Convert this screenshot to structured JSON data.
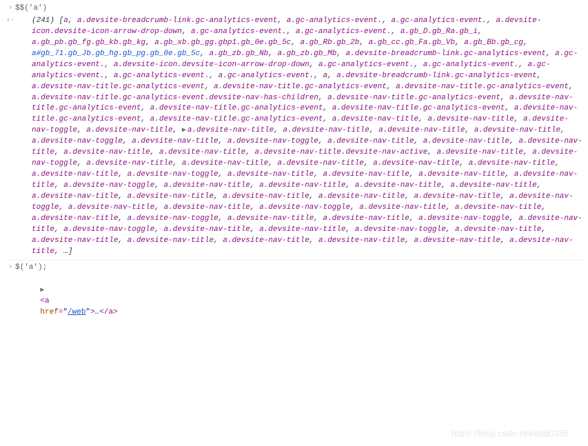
{
  "prompts": {
    "input1": "$$('a')",
    "input2": "$('a');"
  },
  "result1": {
    "count": "(241)",
    "openBracket": "[",
    "closeBracket": "]",
    "ellipsis": "…",
    "tokens": [
      {
        "t": "a",
        "c": "jsvar"
      },
      {
        "t": "a.devsite-breadcrumb-link.gc-analytics-event",
        "c": "sel-purple"
      },
      {
        "t": "a.gc-analytics-event.",
        "c": "sel-purple"
      },
      {
        "t": "a.gc-analytics-event.",
        "c": "sel-purple"
      },
      {
        "t": "a.devsite-icon.devsite-icon-arrow-drop-down",
        "c": "sel-purple"
      },
      {
        "t": "a.gc-analytics-event.",
        "c": "sel-purple"
      },
      {
        "t": "a.gc-analytics-event.",
        "c": "sel-purple"
      },
      {
        "t": "a.gb_D.gb_Ra.gb_i",
        "c": "sel-purple"
      },
      {
        "t": "a.gb_pb.gb_fg.gb_kb.gb_kg",
        "c": "sel-purple"
      },
      {
        "t": "a.gb_xb.gb_gg.gbp1.gb_0e.gb_5c",
        "c": "sel-purple"
      },
      {
        "t": "a.gb_Rb.gb_2b",
        "c": "sel-purple"
      },
      {
        "t": "a.gb_cc.gb_Fa.gb_Vb",
        "c": "sel-purple"
      },
      {
        "t": "a.gb_Bb.gb_cg",
        "c": "sel-purple"
      },
      {
        "t": "a#gb_71.gb_Jb.gb_hg.gb_pg.gb_0e.gb_5c",
        "c": "jsblue"
      },
      {
        "t": "a.gb_zb.gb_Nb",
        "c": "sel-purple"
      },
      {
        "t": "a.gb_zb.gb_Mb",
        "c": "sel-purple"
      },
      {
        "t": "a.devsite-breadcrumb-link.gc-analytics-event",
        "c": "sel-purple"
      },
      {
        "t": "a.gc-analytics-event.",
        "c": "sel-purple"
      },
      {
        "t": "a.devsite-icon.devsite-icon-arrow-drop-down",
        "c": "sel-purple"
      },
      {
        "t": "a.gc-analytics-event.",
        "c": "sel-purple"
      },
      {
        "t": "a.gc-analytics-event.",
        "c": "sel-purple"
      },
      {
        "t": "a.gc-analytics-event.",
        "c": "sel-purple"
      },
      {
        "t": "a.gc-analytics-event.",
        "c": "sel-purple"
      },
      {
        "t": "a.gc-analytics-event.",
        "c": "sel-purple"
      },
      {
        "t": "a",
        "c": "jsvar"
      },
      {
        "t": "a.devsite-breadcrumb-link.gc-analytics-event",
        "c": "sel-purple"
      },
      {
        "t": "a.devsite-nav-title.gc-analytics-event",
        "c": "sel-purple"
      },
      {
        "t": "a.devsite-nav-title.gc-analytics-event",
        "c": "sel-purple"
      },
      {
        "t": "a.devsite-nav-title.gc-analytics-event",
        "c": "sel-purple"
      },
      {
        "t": "a.devsite-nav-title.gc-analytics-event.devsite-nav-has-children",
        "c": "sel-purple"
      },
      {
        "t": "a.devsite-nav-title.gc-analytics-event",
        "c": "sel-purple"
      },
      {
        "t": "a.devsite-nav-title.gc-analytics-event",
        "c": "sel-purple"
      },
      {
        "t": "a.devsite-nav-title.gc-analytics-event",
        "c": "sel-purple"
      },
      {
        "t": "a.devsite-nav-title.gc-analytics-event",
        "c": "sel-purple"
      },
      {
        "t": "a.devsite-nav-title.gc-analytics-event",
        "c": "sel-purple"
      },
      {
        "t": "a.devsite-nav-title.gc-analytics-event",
        "c": "sel-purple"
      },
      {
        "t": "a.devsite-nav-title",
        "c": "sel-purple"
      },
      {
        "t": "a.devsite-nav-title",
        "c": "sel-purple"
      },
      {
        "t": "a.devsite-nav-toggle",
        "c": "sel-purple"
      },
      {
        "t": "a.devsite-nav-title",
        "c": "sel-purple"
      },
      {
        "t": "a.devsite-nav-title",
        "c": "sel-purple"
      },
      {
        "t": "a.devsite-nav-title",
        "c": "sel-purple"
      },
      {
        "t": "a.devsite-nav-title",
        "c": "sel-purple"
      },
      {
        "t": "a.devsite-nav-title",
        "c": "sel-purple"
      },
      {
        "t": "a.devsite-nav-toggle",
        "c": "sel-purple"
      },
      {
        "t": "a.devsite-nav-title",
        "c": "sel-purple"
      },
      {
        "t": "a.devsite-nav-toggle",
        "c": "sel-purple"
      },
      {
        "t": "a.devsite-nav-title",
        "c": "sel-purple"
      },
      {
        "t": "a.devsite-nav-title",
        "c": "sel-purple"
      },
      {
        "t": "a.devsite-nav-title",
        "c": "sel-purple"
      },
      {
        "t": "a.devsite-nav-title",
        "c": "sel-purple"
      },
      {
        "t": "a.devsite-nav-title",
        "c": "sel-purple"
      },
      {
        "t": "a.devsite-nav-title.devsite-nav-active",
        "c": "sel-purple"
      },
      {
        "t": "a.devsite-nav-title",
        "c": "sel-purple"
      },
      {
        "t": "a.devsite-nav-toggle",
        "c": "sel-purple"
      },
      {
        "t": "a.devsite-nav-title",
        "c": "sel-purple"
      },
      {
        "t": "a.devsite-nav-title",
        "c": "sel-purple"
      },
      {
        "t": "a.devsite-nav-title",
        "c": "sel-purple"
      },
      {
        "t": "a.devsite-nav-title",
        "c": "sel-purple"
      },
      {
        "t": "a.devsite-nav-title",
        "c": "sel-purple"
      },
      {
        "t": "a.devsite-nav-title",
        "c": "sel-purple"
      },
      {
        "t": "a.devsite-nav-toggle",
        "c": "sel-purple"
      },
      {
        "t": "a.devsite-nav-title",
        "c": "sel-purple"
      },
      {
        "t": "a.devsite-nav-title",
        "c": "sel-purple"
      },
      {
        "t": "a.devsite-nav-title",
        "c": "sel-purple"
      },
      {
        "t": "a.devsite-nav-title",
        "c": "sel-purple"
      },
      {
        "t": "a.devsite-nav-toggle",
        "c": "sel-purple"
      },
      {
        "t": "a.devsite-nav-title",
        "c": "sel-purple"
      },
      {
        "t": "a.devsite-nav-title",
        "c": "sel-purple"
      },
      {
        "t": "a.devsite-nav-title",
        "c": "sel-purple"
      },
      {
        "t": "a.devsite-nav-title",
        "c": "sel-purple"
      },
      {
        "t": "a.devsite-nav-title",
        "c": "sel-purple"
      },
      {
        "t": "a.devsite-nav-title",
        "c": "sel-purple"
      },
      {
        "t": "a.devsite-nav-title",
        "c": "sel-purple"
      },
      {
        "t": "a.devsite-nav-title",
        "c": "sel-purple"
      },
      {
        "t": "a.devsite-nav-title",
        "c": "sel-purple"
      },
      {
        "t": "a.devsite-nav-toggle",
        "c": "sel-purple"
      },
      {
        "t": "a.devsite-nav-title",
        "c": "sel-purple"
      },
      {
        "t": "a.devsite-nav-title",
        "c": "sel-purple"
      },
      {
        "t": "a.devsite-nav-toggle",
        "c": "sel-purple"
      },
      {
        "t": "a.devsite-nav-title",
        "c": "sel-purple"
      },
      {
        "t": "a.devsite-nav-title",
        "c": "sel-purple"
      },
      {
        "t": "a.devsite-nav-title",
        "c": "sel-purple"
      },
      {
        "t": "a.devsite-nav-toggle",
        "c": "sel-purple"
      },
      {
        "t": "a.devsite-nav-title",
        "c": "sel-purple"
      },
      {
        "t": "a.devsite-nav-title",
        "c": "sel-purple"
      },
      {
        "t": "a.devsite-nav-toggle",
        "c": "sel-purple"
      },
      {
        "t": "a.devsite-nav-title",
        "c": "sel-purple"
      },
      {
        "t": "a.devsite-nav-toggle",
        "c": "sel-purple"
      },
      {
        "t": "a.devsite-nav-title",
        "c": "sel-purple"
      },
      {
        "t": "a.devsite-nav-title",
        "c": "sel-purple"
      },
      {
        "t": "a.devsite-nav-toggle",
        "c": "sel-purple"
      },
      {
        "t": "a.devsite-nav-title",
        "c": "sel-purple"
      },
      {
        "t": "a.devsite-nav-title",
        "c": "sel-purple"
      },
      {
        "t": "a.devsite-nav-title",
        "c": "sel-purple"
      },
      {
        "t": "a.devsite-nav-title",
        "c": "sel-purple"
      },
      {
        "t": "a.devsite-nav-title",
        "c": "sel-purple"
      },
      {
        "t": "a.devsite-nav-title",
        "c": "sel-purple"
      },
      {
        "t": "a.devsite-nav-title",
        "c": "sel-purple"
      }
    ]
  },
  "result2": {
    "tagOpen": "<",
    "tagName": "a",
    "attrHref": "href",
    "eq": "=",
    "q": "\"",
    "hrefVal": "/web",
    "tagClose": ">",
    "ellipsis": "…",
    "endOpen": "</",
    "endClose": ">"
  },
  "glyphs": {
    "prompt": "›",
    "response": "‹·",
    "triRight": "▶",
    "triExpand": "▶"
  },
  "watermark": "https://blog.csdn.net/asd0356"
}
